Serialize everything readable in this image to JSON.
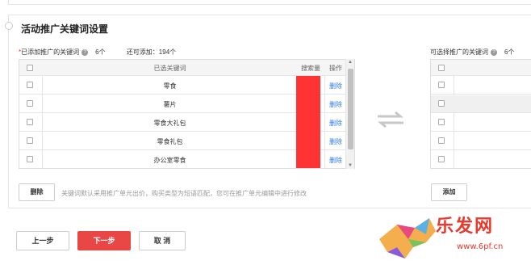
{
  "section": {
    "title": "活动推广关键词设置"
  },
  "left": {
    "label_req": "*",
    "label": "已添加推广的关键词",
    "count": "6个",
    "remaining": "还可添加：194个",
    "headers": {
      "keyword": "已选关键词",
      "search": "搜索量",
      "op": "操作"
    },
    "rows": [
      {
        "keyword": "零食",
        "op": "删除"
      },
      {
        "keyword": "薯片",
        "op": "删除"
      },
      {
        "keyword": "零食大礼包",
        "op": "删除"
      },
      {
        "keyword": "零食礼包",
        "op": "删除"
      },
      {
        "keyword": "办公室零食",
        "op": "删除"
      }
    ],
    "delete_button": "删除",
    "hint": "关键词默认采用推广单元出价，购买类型为短语匹配，您可在推广单元编辑中进行修改"
  },
  "right": {
    "label": "可选择推广的关键词",
    "count": "6个",
    "add_button": "添加"
  },
  "footer": {
    "prev": "上一步",
    "next": "下一步",
    "cancel": "取 消"
  },
  "watermark": {
    "name": "乐发网",
    "url": "www.6pf.cn"
  },
  "colors": {
    "primary": "#e94646",
    "link": "#2a7ae2",
    "redacted": "#ff3333"
  }
}
